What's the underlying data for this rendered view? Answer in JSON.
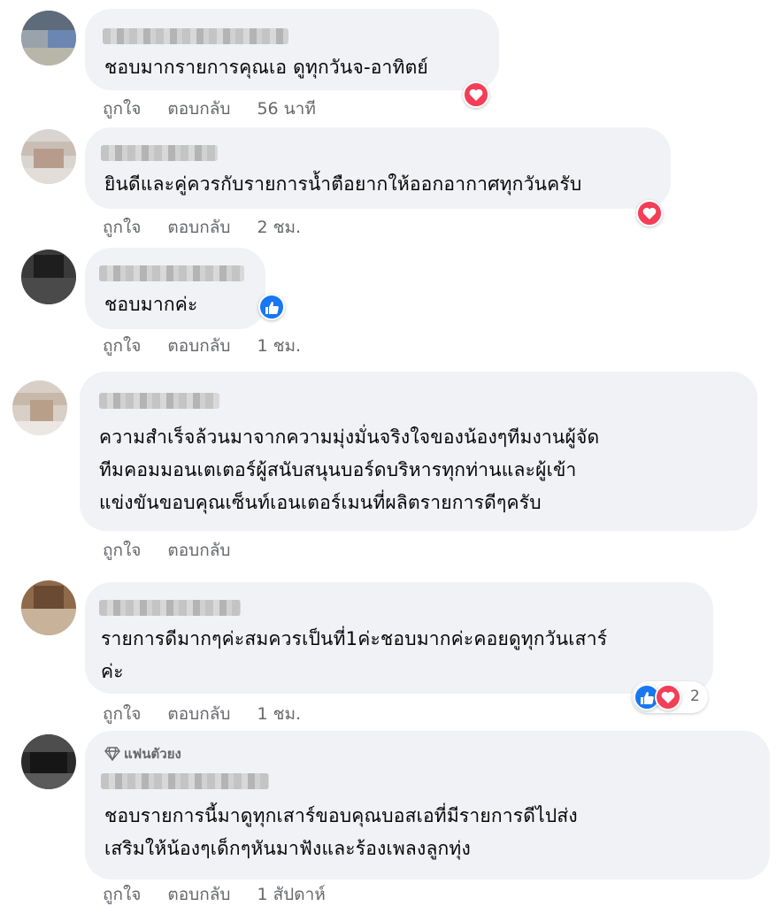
{
  "comments": [
    {
      "text": "ชอบมากรายการคุณเอ ดูทุกวันจ-อาทิตย์",
      "like": "ถูกใจ",
      "reply": "ตอบกลับ",
      "time": "56 นาที",
      "reaction": "love"
    },
    {
      "text": "ยินดีและคู่ควรกับรายการน้ำตือยากให้ออกอากาศทุกวันครับ",
      "like": "ถูกใจ",
      "reply": "ตอบกลับ",
      "time": "2 ชม.",
      "reaction": "love"
    },
    {
      "text": "ชอบมากค่ะ",
      "like": "ถูกใจ",
      "reply": "ตอบกลับ",
      "time": "1 ชม.",
      "reaction": "like"
    },
    {
      "text": "ความสำเร็จล้วนมาจากความมุ่งมั่นจริงใจของน้องๆทีมงานผู้จัด\nทีมคอมมอนเตเตอร์ผู้สนับสนุนบอร์ดบริหารทุกท่านและผู้เข้า\nแข่งขันขอบคุณเซ็นท์เอนเตอร์เมนที่ผลิตรายการดีๆครับ",
      "like": "ถูกใจ",
      "reply": "ตอบกลับ",
      "time": ""
    },
    {
      "text": "รายการดีมากๆค่ะสมควรเป็นที่1ค่ะชอบมากค่ะคอยดูทุกวันเสาร์\nค่ะ",
      "like": "ถูกใจ",
      "reply": "ตอบกลับ",
      "time": "1 ชม.",
      "reaction_count": "2"
    },
    {
      "badge": "แฟนตัวยง",
      "text": "ชอบรายการนี้มาดูทุกเสาร์ขอบคุณบอสเอที่มีรายการดีไปส่ง\nเสริมให้น้องๆเด็กๆหันมาฟังและร้องเพลงลูกทุ่ง",
      "like": "ถูกใจ",
      "reply": "ตอบกลับ",
      "time": "1 สัปดาห์"
    }
  ],
  "colors": {
    "bubble": "#f0f2f5",
    "love": "#f33e58",
    "like": "#1877f2",
    "meta": "#65676b"
  },
  "icons": {
    "love": "heart-icon",
    "like": "thumbs-up-icon",
    "badge": "diamond-icon"
  }
}
